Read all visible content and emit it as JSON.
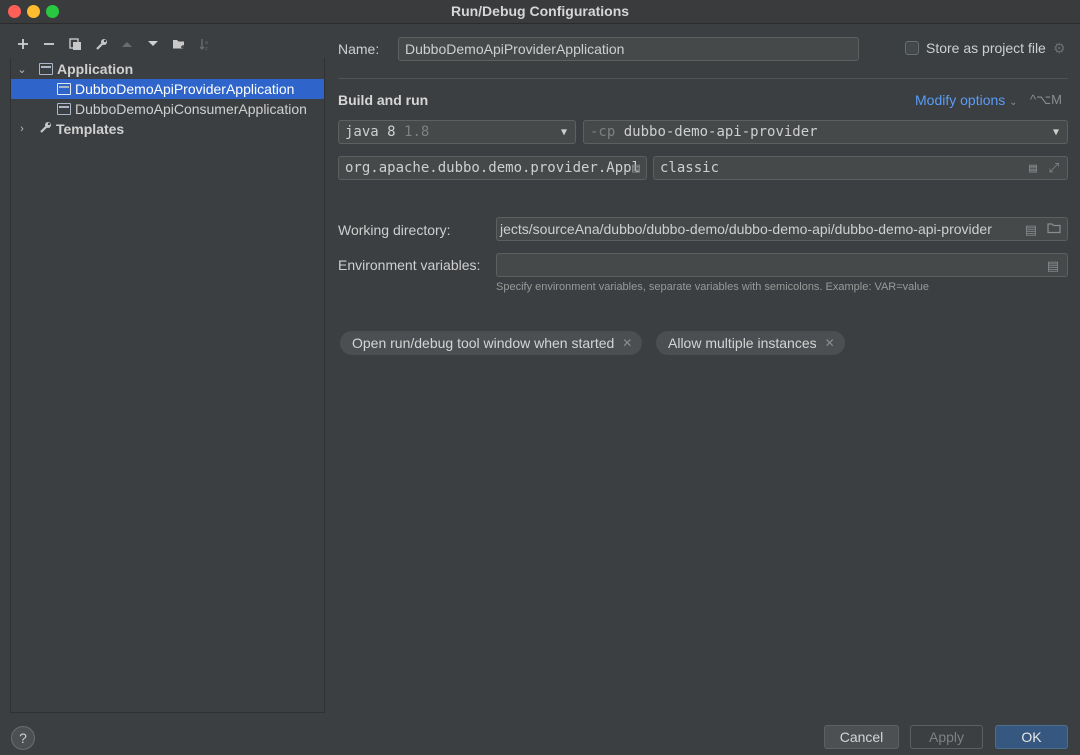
{
  "window": {
    "title": "Run/Debug Configurations"
  },
  "toolbar": {
    "icons": [
      "add-icon",
      "remove-icon",
      "copy-icon",
      "wrench-icon",
      "move-up-icon",
      "move-down-icon",
      "new-folder-icon",
      "sort-icon"
    ]
  },
  "tree": {
    "application_label": "Application",
    "items": [
      {
        "label": "DubboDemoApiProviderApplication",
        "selected": true
      },
      {
        "label": "DubboDemoApiConsumerApplication",
        "selected": false
      }
    ],
    "templates_label": "Templates"
  },
  "form": {
    "name_label": "Name:",
    "name_value": "DubboDemoApiProviderApplication",
    "store_label": "Store as project file",
    "section_title": "Build and run",
    "modify_options": "Modify options",
    "modify_shortcut": "^⌥M",
    "jre_value": "java 8",
    "jre_version": "1.8",
    "cp_flag": "-cp",
    "cp_value": "dubbo-demo-api-provider",
    "main_class": "org.apache.dubbo.demo.provider.Appl",
    "program_args": "classic",
    "working_dir_label": "Working directory:",
    "working_dir_value": "jects/sourceAna/dubbo/dubbo-demo/dubbo-demo-api/dubbo-demo-api-provider",
    "env_label": "Environment variables:",
    "env_value": "",
    "env_hint": "Specify environment variables, separate variables with semicolons. Example: VAR=value",
    "chips": [
      "Open run/debug tool window when started",
      "Allow multiple instances"
    ]
  },
  "footer": {
    "help": "?",
    "cancel": "Cancel",
    "apply": "Apply",
    "ok": "OK"
  },
  "colors": {
    "background": "#3c3f41",
    "selection": "#2f65ca",
    "link": "#589df6",
    "ok_button": "#365880"
  }
}
